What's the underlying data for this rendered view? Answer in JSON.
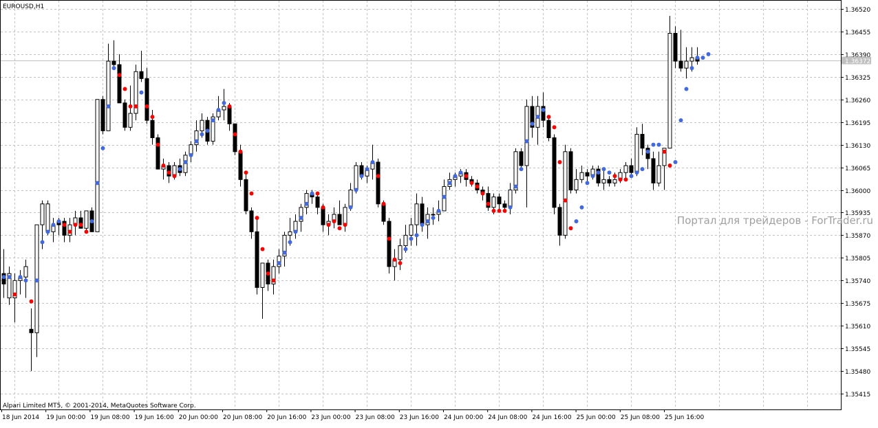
{
  "chart_data": {
    "type": "candlestick",
    "title": "EUROUSD,H1",
    "copyright": "Alpari Limited MT5, © 2001-2014, MetaQuotes Software Corp.",
    "watermark": "Портал для трейдеров - ForTrader.ru",
    "ylim": [
      1.3538,
      1.3656
    ],
    "y_ticks": [
      "1.36520",
      "1.36455",
      "1.36390",
      "1.36325",
      "1.36260",
      "1.36195",
      "1.36130",
      "1.36065",
      "1.36000",
      "1.35935",
      "1.35870",
      "1.35805",
      "1.35740",
      "1.35675",
      "1.35610",
      "1.35545",
      "1.35480",
      "1.35415"
    ],
    "current_price": "1.36372",
    "x_ticks": [
      "18 Jun 2014",
      "19 Jun 00:00",
      "19 Jun 08:00",
      "19 Jun 16:00",
      "20 Jun 00:00",
      "20 Jun 08:00",
      "20 Jun 16:00",
      "23 Jun 00:00",
      "23 Jun 08:00",
      "23 Jun 16:00",
      "24 Jun 00:00",
      "24 Jun 08:00",
      "24 Jun 16:00",
      "25 Jun 00:00",
      "25 Jun 08:00",
      "25 Jun 16:00"
    ],
    "grid": true,
    "colors": {
      "background": "#ffffff",
      "grid": "#c0c0c0",
      "bull_body": "#ffffff",
      "bear_body": "#000000",
      "wick": "#000000",
      "dot_up": "#4169e1",
      "dot_down": "#ff0000",
      "price_line": "#c0c0c0",
      "price_label_bg": "#c0c0c0",
      "price_label_text": "#ffffff"
    },
    "candles": [
      [
        1.3573,
        1.3583,
        1.3569,
        1.3576,
        "d"
      ],
      [
        1.3576,
        1.3578,
        1.3567,
        1.3569,
        "u"
      ],
      [
        1.3569,
        1.3576,
        1.3562,
        1.3574,
        "u"
      ],
      [
        1.3574,
        1.3577,
        1.357,
        1.3575,
        "u"
      ],
      [
        1.3575,
        1.358,
        1.3569,
        1.3578,
        "u"
      ],
      [
        1.356,
        1.3566,
        1.3548,
        1.3559,
        "d"
      ],
      [
        1.3559,
        1.359,
        1.3552,
        1.359,
        "u"
      ],
      [
        1.359,
        1.3597,
        1.3583,
        1.3596,
        "u"
      ],
      [
        1.3596,
        1.3597,
        1.3587,
        1.3588,
        "u"
      ],
      [
        1.3588,
        1.3592,
        1.3585,
        1.359,
        "u"
      ],
      [
        1.359,
        1.3592,
        1.3587,
        1.3591,
        "d"
      ],
      [
        1.3591,
        1.3592,
        1.3585,
        1.3587,
        "d"
      ],
      [
        1.3587,
        1.3592,
        1.3585,
        1.359,
        "u"
      ],
      [
        1.359,
        1.3594,
        1.3587,
        1.3592,
        "u"
      ],
      [
        1.3592,
        1.3594,
        1.3589,
        1.3589,
        "d"
      ],
      [
        1.3589,
        1.3594,
        1.3588,
        1.3594,
        "u"
      ],
      [
        1.3588,
        1.3595,
        1.3588,
        1.3594,
        "d"
      ],
      [
        1.3588,
        1.3626,
        1.3588,
        1.3626,
        "u"
      ],
      [
        1.3626,
        1.3627,
        1.3616,
        1.3617,
        "d"
      ],
      [
        1.3617,
        1.3642,
        1.3617,
        1.3637,
        "u"
      ],
      [
        1.3637,
        1.3643,
        1.3635,
        1.3636,
        "d"
      ],
      [
        1.3636,
        1.3639,
        1.3625,
        1.3625,
        "d"
      ],
      [
        1.3625,
        1.3626,
        1.3617,
        1.3618,
        "d"
      ],
      [
        1.3618,
        1.363,
        1.3617,
        1.3622,
        "u"
      ],
      [
        1.3622,
        1.3636,
        1.362,
        1.3634,
        "u"
      ],
      [
        1.3634,
        1.364,
        1.3631,
        1.3632,
        "d"
      ],
      [
        1.3632,
        1.3635,
        1.3619,
        1.362,
        "d"
      ],
      [
        1.362,
        1.3623,
        1.3613,
        1.3615,
        "d"
      ],
      [
        1.3615,
        1.3616,
        1.3606,
        1.3606,
        "d"
      ],
      [
        1.3606,
        1.3609,
        1.3603,
        1.3607,
        "u"
      ],
      [
        1.3607,
        1.3608,
        1.3602,
        1.3604,
        "d"
      ],
      [
        1.3604,
        1.3608,
        1.3603,
        1.3607,
        "u"
      ],
      [
        1.3607,
        1.3609,
        1.3604,
        1.3605,
        "d"
      ],
      [
        1.3605,
        1.3611,
        1.3604,
        1.361,
        "u"
      ],
      [
        1.361,
        1.3614,
        1.3608,
        1.3613,
        "u"
      ],
      [
        1.3613,
        1.362,
        1.3611,
        1.3617,
        "u"
      ],
      [
        1.3617,
        1.3622,
        1.3615,
        1.362,
        "u"
      ],
      [
        1.362,
        1.3621,
        1.3613,
        1.3614,
        "d"
      ],
      [
        1.3614,
        1.3622,
        1.3613,
        1.3621,
        "u"
      ],
      [
        1.3621,
        1.3627,
        1.362,
        1.3623,
        "u"
      ],
      [
        1.3623,
        1.3629,
        1.362,
        1.3624,
        "u"
      ],
      [
        1.3624,
        1.3625,
        1.3617,
        1.3619,
        "d"
      ],
      [
        1.3619,
        1.3619,
        1.361,
        1.3611,
        "d"
      ],
      [
        1.3611,
        1.3613,
        1.3601,
        1.3603,
        "d"
      ],
      [
        1.3603,
        1.3605,
        1.3593,
        1.3594,
        "d"
      ],
      [
        1.3594,
        1.3595,
        1.3586,
        1.3588,
        "d"
      ],
      [
        1.3588,
        1.3592,
        1.357,
        1.3572,
        "d"
      ],
      [
        1.3572,
        1.3579,
        1.3563,
        1.3579,
        "u"
      ],
      [
        1.3579,
        1.358,
        1.3571,
        1.3573,
        "d"
      ],
      [
        1.3573,
        1.358,
        1.357,
        1.3578,
        "u"
      ],
      [
        1.3578,
        1.3583,
        1.3576,
        1.3581,
        "u"
      ],
      [
        1.3581,
        1.3588,
        1.3578,
        1.3587,
        "u"
      ],
      [
        1.3587,
        1.3592,
        1.3584,
        1.3588,
        "u"
      ],
      [
        1.3588,
        1.3593,
        1.3586,
        1.3591,
        "u"
      ],
      [
        1.3591,
        1.3596,
        1.3588,
        1.3595,
        "u"
      ],
      [
        1.3595,
        1.36,
        1.3593,
        1.3599,
        "u"
      ],
      [
        1.3599,
        1.36,
        1.3596,
        1.3598,
        "d"
      ],
      [
        1.3598,
        1.3599,
        1.3593,
        1.3595,
        "d"
      ],
      [
        1.3595,
        1.3596,
        1.3588,
        1.359,
        "d"
      ],
      [
        1.359,
        1.3593,
        1.3587,
        1.3591,
        "u"
      ],
      [
        1.3591,
        1.3595,
        1.3589,
        1.3593,
        "u"
      ],
      [
        1.3593,
        1.3597,
        1.359,
        1.359,
        "d"
      ],
      [
        1.359,
        1.3596,
        1.3588,
        1.3595,
        "u"
      ],
      [
        1.3595,
        1.3602,
        1.3594,
        1.36,
        "u"
      ],
      [
        1.36,
        1.3608,
        1.3599,
        1.3607,
        "u"
      ],
      [
        1.3607,
        1.3608,
        1.3603,
        1.3604,
        "d"
      ],
      [
        1.3604,
        1.3607,
        1.3602,
        1.3606,
        "u"
      ],
      [
        1.3606,
        1.3613,
        1.3603,
        1.3608,
        "u"
      ],
      [
        1.3608,
        1.3609,
        1.3595,
        1.3596,
        "d"
      ],
      [
        1.3596,
        1.3597,
        1.359,
        1.3591,
        "d"
      ],
      [
        1.3591,
        1.3592,
        1.3576,
        1.3578,
        "d"
      ],
      [
        1.3578,
        1.3583,
        1.3574,
        1.358,
        "u"
      ],
      [
        1.358,
        1.3586,
        1.3577,
        1.3584,
        "u"
      ],
      [
        1.3584,
        1.359,
        1.3582,
        1.3587,
        "u"
      ],
      [
        1.3587,
        1.3592,
        1.3584,
        1.359,
        "u"
      ],
      [
        1.359,
        1.3599,
        1.3584,
        1.3596,
        "u"
      ],
      [
        1.3596,
        1.3598,
        1.3588,
        1.359,
        "d"
      ],
      [
        1.359,
        1.3595,
        1.3586,
        1.3593,
        "u"
      ],
      [
        1.3593,
        1.3595,
        1.359,
        1.3593,
        "u"
      ],
      [
        1.3593,
        1.3597,
        1.3591,
        1.3594,
        "u"
      ],
      [
        1.3594,
        1.3603,
        1.3594,
        1.3601,
        "u"
      ],
      [
        1.3601,
        1.3605,
        1.36,
        1.3603,
        "u"
      ],
      [
        1.3603,
        1.3605,
        1.3601,
        1.3604,
        "u"
      ],
      [
        1.3604,
        1.3606,
        1.3602,
        1.3605,
        "u"
      ],
      [
        1.3605,
        1.3606,
        1.3601,
        1.3603,
        "d"
      ],
      [
        1.3603,
        1.3604,
        1.3601,
        1.3602,
        "d"
      ],
      [
        1.3602,
        1.3603,
        1.3599,
        1.36,
        "d"
      ],
      [
        1.36,
        1.3601,
        1.3597,
        1.3599,
        "d"
      ],
      [
        1.3599,
        1.3601,
        1.3594,
        1.3595,
        "d"
      ],
      [
        1.3595,
        1.3599,
        1.3593,
        1.3598,
        "u"
      ],
      [
        1.3598,
        1.3599,
        1.3594,
        1.3596,
        "d"
      ],
      [
        1.3596,
        1.3597,
        1.3594,
        1.3595,
        "d"
      ],
      [
        1.3595,
        1.3602,
        1.3593,
        1.36,
        "u"
      ],
      [
        1.36,
        1.3612,
        1.3599,
        1.3611,
        "u"
      ],
      [
        1.3611,
        1.3612,
        1.3606,
        1.3607,
        "d"
      ],
      [
        1.3607,
        1.3626,
        1.3595,
        1.3624,
        "u"
      ],
      [
        1.3624,
        1.3627,
        1.3615,
        1.3618,
        "d"
      ],
      [
        1.3618,
        1.3627,
        1.3613,
        1.3624,
        "u"
      ],
      [
        1.3624,
        1.3628,
        1.3618,
        1.362,
        "d"
      ],
      [
        1.362,
        1.3621,
        1.3614,
        1.3615,
        "d"
      ],
      [
        1.3615,
        1.3616,
        1.3593,
        1.3595,
        "d"
      ],
      [
        1.3595,
        1.3596,
        1.3584,
        1.3587,
        "d"
      ],
      [
        1.3587,
        1.3613,
        1.3586,
        1.3611,
        "u"
      ],
      [
        1.3611,
        1.3612,
        1.3599,
        1.36,
        "d"
      ],
      [
        1.36,
        1.3606,
        1.3599,
        1.3603,
        "u"
      ],
      [
        1.3603,
        1.3607,
        1.3602,
        1.3605,
        "u"
      ],
      [
        1.3605,
        1.3606,
        1.3602,
        1.3604,
        "d"
      ],
      [
        1.3604,
        1.3607,
        1.3603,
        1.3606,
        "u"
      ],
      [
        1.3606,
        1.3607,
        1.3601,
        1.3602,
        "d"
      ],
      [
        1.3602,
        1.3606,
        1.36,
        1.3603,
        "u"
      ],
      [
        1.3603,
        1.3604,
        1.3601,
        1.3602,
        "d"
      ],
      [
        1.3602,
        1.3605,
        1.3601,
        1.3603,
        "u"
      ],
      [
        1.3603,
        1.3606,
        1.3602,
        1.3605,
        "u"
      ],
      [
        1.3605,
        1.3608,
        1.3603,
        1.3607,
        "u"
      ],
      [
        1.3607,
        1.3609,
        1.3604,
        1.3605,
        "d"
      ],
      [
        1.3605,
        1.3618,
        1.3604,
        1.3616,
        "u"
      ],
      [
        1.3616,
        1.3619,
        1.361,
        1.3612,
        "d"
      ],
      [
        1.3612,
        1.3613,
        1.3606,
        1.3609,
        "d"
      ],
      [
        1.3609,
        1.3611,
        1.36,
        1.3602,
        "d"
      ],
      [
        1.3602,
        1.3611,
        1.3601,
        1.3607,
        "u"
      ],
      [
        1.3607,
        1.3612,
        1.36,
        1.3612,
        "u"
      ],
      [
        1.3612,
        1.365,
        1.3612,
        1.3645,
        "u"
      ],
      [
        1.3645,
        1.3647,
        1.3635,
        1.3637,
        "d"
      ],
      [
        1.3637,
        1.3646,
        1.3634,
        1.3635,
        "d"
      ],
      [
        1.3635,
        1.3641,
        1.3632,
        1.3637,
        "u"
      ],
      [
        1.3637,
        1.3641,
        1.3634,
        1.3638,
        "u"
      ],
      [
        1.3638,
        1.3641,
        1.3636,
        1.3637,
        "d"
      ]
    ],
    "indicator_dots": [
      [
        1.3575,
        "u"
      ],
      [
        1.3575,
        "u"
      ],
      [
        1.357,
        "d"
      ],
      [
        1.3575,
        "u"
      ],
      [
        1.3574,
        "u"
      ],
      [
        1.3568,
        "d"
      ],
      [
        1.3574,
        "u"
      ],
      [
        1.3585,
        "u"
      ],
      [
        1.3588,
        "u"
      ],
      [
        1.359,
        "u"
      ],
      [
        1.3591,
        "u"
      ],
      [
        1.359,
        "d"
      ],
      [
        1.3588,
        "d"
      ],
      [
        1.359,
        "d"
      ],
      [
        1.359,
        "d"
      ],
      [
        1.3588,
        "d"
      ],
      [
        1.3591,
        "u"
      ],
      [
        1.3602,
        "u"
      ],
      [
        1.3612,
        "u"
      ],
      [
        1.3624,
        "u"
      ],
      [
        1.3635,
        "u"
      ],
      [
        1.3633,
        "d"
      ],
      [
        1.3629,
        "d"
      ],
      [
        1.3624,
        "d"
      ],
      [
        1.3624,
        "d"
      ],
      [
        1.3628,
        "u"
      ],
      [
        1.3624,
        "d"
      ],
      [
        1.3621,
        "d"
      ],
      [
        1.3613,
        "d"
      ],
      [
        1.3607,
        "d"
      ],
      [
        1.3605,
        "d"
      ],
      [
        1.3604,
        "d"
      ],
      [
        1.3606,
        "u"
      ],
      [
        1.3608,
        "u"
      ],
      [
        1.361,
        "u"
      ],
      [
        1.3614,
        "u"
      ],
      [
        1.3616,
        "u"
      ],
      [
        1.3617,
        "u"
      ],
      [
        1.362,
        "u"
      ],
      [
        1.3623,
        "u"
      ],
      [
        1.3625,
        "u"
      ],
      [
        1.3624,
        "d"
      ],
      [
        1.3616,
        "d"
      ],
      [
        1.3611,
        "d"
      ],
      [
        1.3605,
        "d"
      ],
      [
        1.3599,
        "d"
      ],
      [
        1.3592,
        "d"
      ],
      [
        1.3583,
        "d"
      ],
      [
        1.3576,
        "d"
      ],
      [
        1.3574,
        "d"
      ],
      [
        1.3579,
        "u"
      ],
      [
        1.3582,
        "u"
      ],
      [
        1.3585,
        "u"
      ],
      [
        1.3588,
        "u"
      ],
      [
        1.3592,
        "u"
      ],
      [
        1.3596,
        "u"
      ],
      [
        1.3599,
        "u"
      ],
      [
        1.3599,
        "d"
      ],
      [
        1.3595,
        "d"
      ],
      [
        1.359,
        "d"
      ],
      [
        1.3591,
        "d"
      ],
      [
        1.3589,
        "d"
      ],
      [
        1.359,
        "d"
      ],
      [
        1.3595,
        "u"
      ],
      [
        1.36,
        "u"
      ],
      [
        1.3604,
        "u"
      ],
      [
        1.3606,
        "u"
      ],
      [
        1.3608,
        "u"
      ],
      [
        1.3604,
        "d"
      ],
      [
        1.3596,
        "d"
      ],
      [
        1.3586,
        "d"
      ],
      [
        1.358,
        "d"
      ],
      [
        1.3579,
        "d"
      ],
      [
        1.3583,
        "u"
      ],
      [
        1.3586,
        "u"
      ],
      [
        1.3587,
        "u"
      ],
      [
        1.359,
        "u"
      ],
      [
        1.3591,
        "u"
      ],
      [
        1.3592,
        "u"
      ],
      [
        1.3594,
        "u"
      ],
      [
        1.3598,
        "u"
      ],
      [
        1.3602,
        "u"
      ],
      [
        1.3604,
        "u"
      ],
      [
        1.3605,
        "u"
      ],
      [
        1.3604,
        "d"
      ],
      [
        1.3602,
        "d"
      ],
      [
        1.3601,
        "d"
      ],
      [
        1.3599,
        "d"
      ],
      [
        1.3596,
        "d"
      ],
      [
        1.3594,
        "d"
      ],
      [
        1.3594,
        "d"
      ],
      [
        1.3594,
        "d"
      ],
      [
        1.3595,
        "u"
      ],
      [
        1.3601,
        "u"
      ],
      [
        1.3606,
        "u"
      ],
      [
        1.3614,
        "u"
      ],
      [
        1.3619,
        "u"
      ],
      [
        1.3621,
        "u"
      ],
      [
        1.3623,
        "u"
      ],
      [
        1.3621,
        "d"
      ],
      [
        1.3618,
        "d"
      ],
      [
        1.3608,
        "d"
      ],
      [
        1.3597,
        "d"
      ],
      [
        1.3589,
        "d"
      ],
      [
        1.3591,
        "u"
      ],
      [
        1.3595,
        "u"
      ],
      [
        1.3602,
        "u"
      ],
      [
        1.3604,
        "u"
      ],
      [
        1.3605,
        "u"
      ],
      [
        1.3606,
        "u"
      ],
      [
        1.3605,
        "u"
      ],
      [
        1.3604,
        "d"
      ],
      [
        1.3603,
        "d"
      ],
      [
        1.3603,
        "d"
      ],
      [
        1.3604,
        "u"
      ],
      [
        1.3605,
        "u"
      ],
      [
        1.3606,
        "u"
      ],
      [
        1.3611,
        "u"
      ],
      [
        1.3613,
        "u"
      ],
      [
        1.3613,
        "u"
      ],
      [
        1.3611,
        "d"
      ],
      [
        1.3607,
        "d"
      ],
      [
        1.3608,
        "u"
      ],
      [
        1.362,
        "u"
      ],
      [
        1.3629,
        "u"
      ],
      [
        1.3635,
        "u"
      ],
      [
        1.3638,
        "u"
      ],
      [
        1.3638,
        "u"
      ],
      [
        1.3639,
        "u"
      ]
    ]
  }
}
